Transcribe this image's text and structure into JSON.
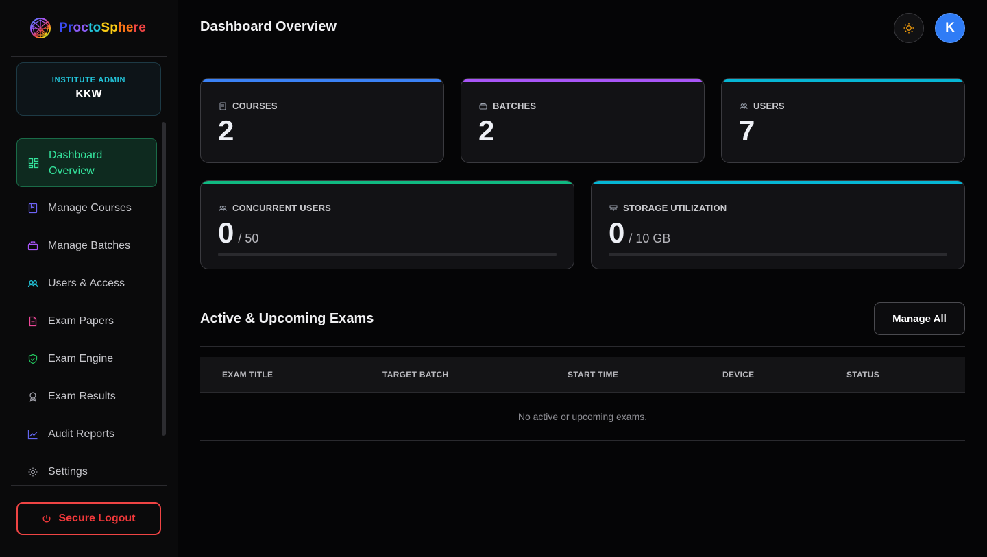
{
  "brand": {
    "name_parts": [
      "Pr",
      "oc",
      "to",
      "Sp",
      "he",
      "re"
    ],
    "name_colors": [
      "#3b4cf5",
      "#8b5cf6",
      "#22c3d8",
      "#facc15",
      "#f97316",
      "#ef4444"
    ]
  },
  "role": {
    "label": "INSTITUTE ADMIN",
    "name": "KKW"
  },
  "nav": {
    "items": [
      {
        "label": "Dashboard Overview",
        "icon": "dashboard-icon",
        "color": "#34e39c",
        "active": true
      },
      {
        "label": "Manage Courses",
        "icon": "book-icon",
        "color": "#6d63f6"
      },
      {
        "label": "Manage Batches",
        "icon": "briefcase-icon",
        "color": "#a855f7"
      },
      {
        "label": "Users & Access",
        "icon": "users-icon",
        "color": "#22c3d8"
      },
      {
        "label": "Exam Papers",
        "icon": "document-icon",
        "color": "#ec4899"
      },
      {
        "label": "Exam Engine",
        "icon": "shield-check-icon",
        "color": "#22c55e"
      },
      {
        "label": "Exam Results",
        "icon": "award-icon",
        "color": "#9ca3af"
      },
      {
        "label": "Audit Reports",
        "icon": "trend-chart-icon",
        "color": "#6366f1"
      },
      {
        "label": "Settings",
        "icon": "gear-icon",
        "color": "#9ca3af"
      }
    ]
  },
  "logout": {
    "label": "Secure Logout",
    "color": "#ef4444"
  },
  "header": {
    "title": "Dashboard Overview",
    "avatar_initial": "K"
  },
  "stats": {
    "courses": {
      "label": "COURSES",
      "value": "2",
      "accent": "#3b82f6"
    },
    "batches": {
      "label": "BATCHES",
      "value": "2",
      "accent": "#a855f7"
    },
    "users": {
      "label": "USERS",
      "value": "7",
      "accent": "#06b6d4"
    },
    "concurrent": {
      "label": "CONCURRENT USERS",
      "value": "0",
      "max": "/ 50",
      "fraction": 0,
      "accent": "#10b981"
    },
    "storage": {
      "label": "STORAGE UTILIZATION",
      "value": "0",
      "max": "/ 10 GB",
      "fraction": 0,
      "accent": "#06b6d4"
    }
  },
  "exams": {
    "title": "Active & Upcoming Exams",
    "manage_label": "Manage All",
    "columns": [
      "EXAM TITLE",
      "TARGET BATCH",
      "START TIME",
      "DEVICE",
      "STATUS"
    ],
    "empty_text": "No active or upcoming exams."
  }
}
